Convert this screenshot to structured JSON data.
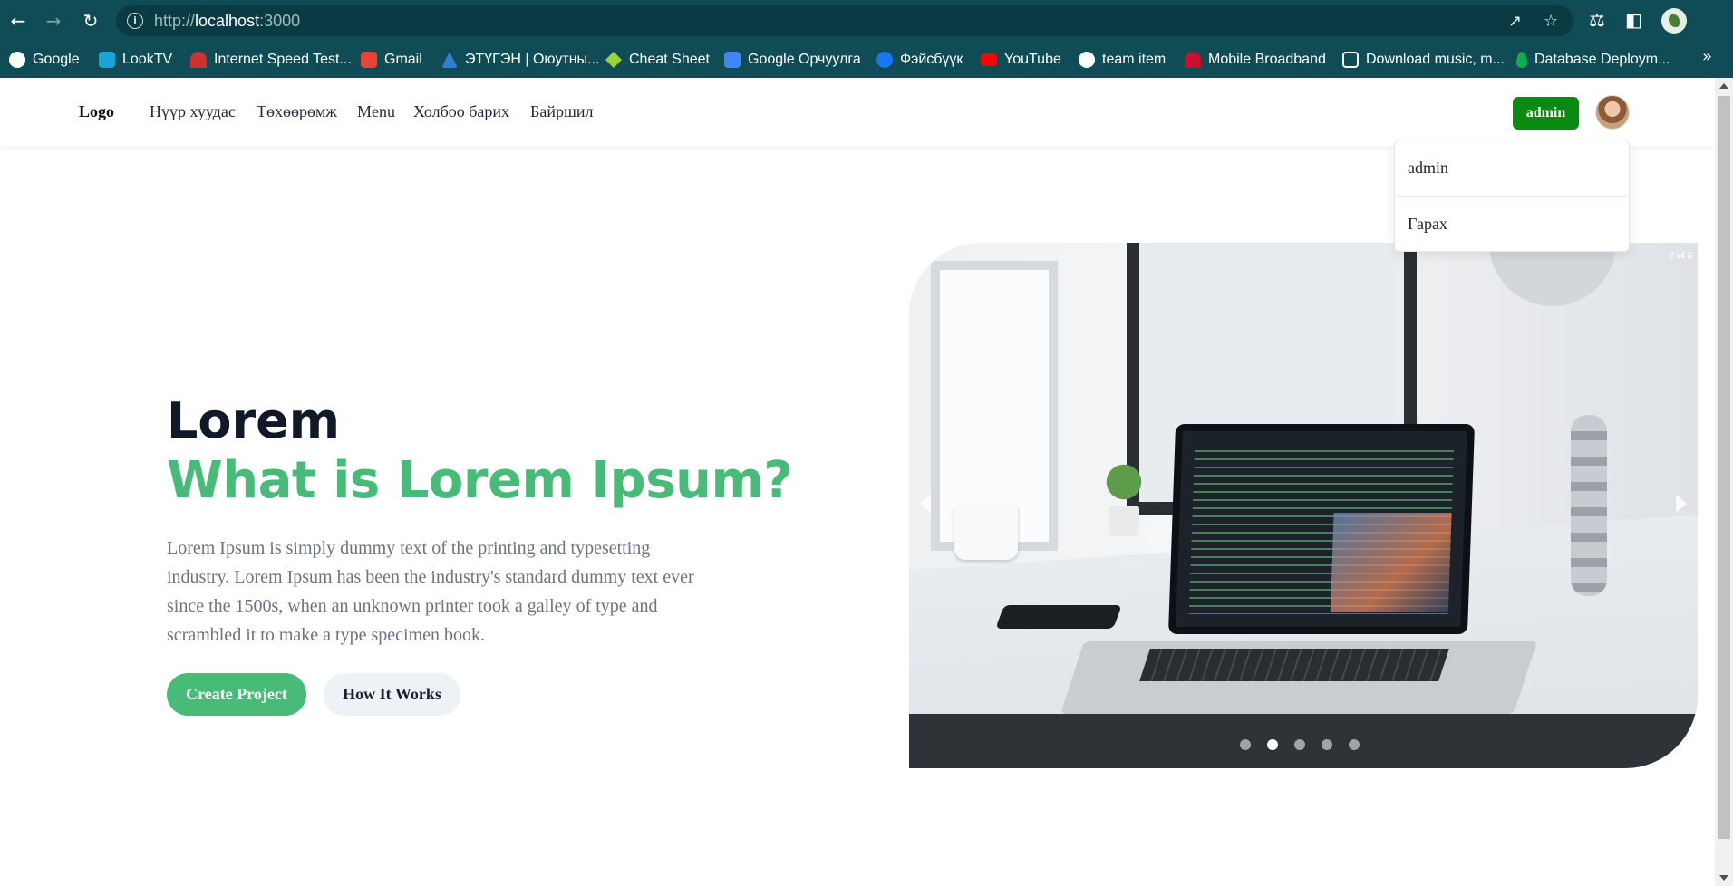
{
  "browser": {
    "url_scheme": "http://",
    "url_host": "localhost",
    "url_port": ":3000",
    "back_icon": "arrow-left-icon",
    "forward_icon": "arrow-right-icon",
    "reload_icon": "reload-icon",
    "bookmarks": [
      {
        "label": "Google",
        "color": "#ffffff"
      },
      {
        "label": "LookTV",
        "color": "#1aa3d9"
      },
      {
        "label": "Internet Speed Test...",
        "color": "#d03030"
      },
      {
        "label": "Gmail",
        "color": "#ea4335"
      },
      {
        "label": "ЭТҮГЭН | Оюутны...",
        "color": "#2f7fd1"
      },
      {
        "label": "Cheat Sheet",
        "color": "#9bd23c"
      },
      {
        "label": "Google Орчуулга",
        "color": "#4285f4"
      },
      {
        "label": "Фэйсбүүк",
        "color": "#1877f2"
      },
      {
        "label": "YouTube",
        "color": "#ff0000"
      },
      {
        "label": "team item",
        "color": "#ffffff"
      },
      {
        "label": "Mobile Broadband",
        "color": "#c8102e"
      },
      {
        "label": "Download music, m...",
        "color": "#ffffff"
      },
      {
        "label": "Database Deploym...",
        "color": "#13aa52"
      }
    ],
    "more_label": "»"
  },
  "header": {
    "logo": "Logo",
    "nav": [
      "Нүүр хуудас",
      "Төхөөрөмж",
      "Menu",
      "Холбоо барих",
      "Байршил"
    ],
    "admin_button": "admin",
    "dropdown": [
      "admin",
      "Гарах"
    ]
  },
  "hero": {
    "eyebrow": "Lorem",
    "title": "What is Lorem Ipsum?",
    "description": "Lorem Ipsum is simply dummy text of the printing and typesetting industry. Lorem Ipsum has been the industry's standard dummy text ever since the 1500s, when an unknown printer took a galley of type and scrambled it to make a type specimen book.",
    "primary_button": "Create Project",
    "secondary_button": "How It Works"
  },
  "carousel": {
    "counter": "2 of 5",
    "active_slide": 2,
    "slide_count": 5
  },
  "colors": {
    "browser_bg": "#0f4c56",
    "admin_green": "#0b8a12",
    "accent_green": "#48bb78"
  }
}
